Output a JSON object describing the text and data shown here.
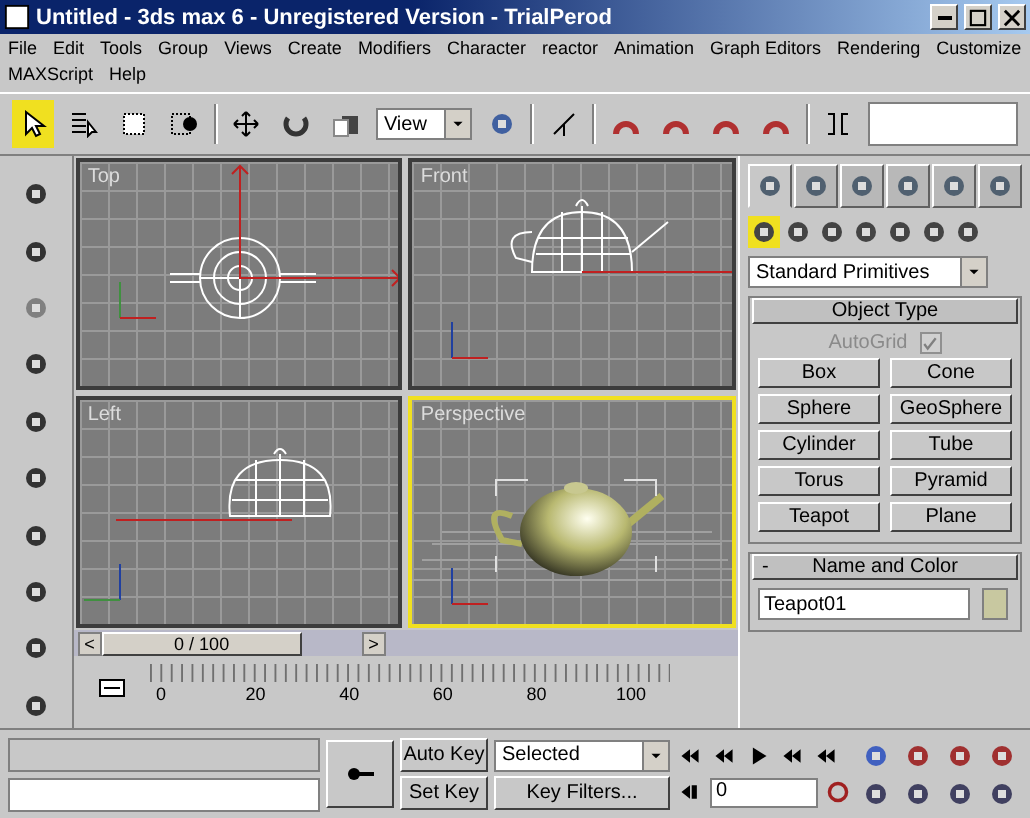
{
  "window": {
    "title": "Untitled - 3ds max 6 - Unregistered Version - TrialPerod"
  },
  "menu": [
    "File",
    "Edit",
    "Tools",
    "Group",
    "Views",
    "Create",
    "Modifiers",
    "Character",
    "reactor",
    "Animation",
    "Graph Editors",
    "Rendering",
    "Customize",
    "MAXScript",
    "Help"
  ],
  "toolbar": {
    "tools": [
      {
        "selected": true
      },
      {
        "selected": false
      },
      {
        "selected": false
      },
      {
        "selected": false
      }
    ],
    "coordinate_system": "View"
  },
  "viewports": [
    {
      "label": "Top",
      "kind": "top",
      "active": false
    },
    {
      "label": "Front",
      "kind": "front",
      "active": false
    },
    {
      "label": "Left",
      "kind": "left",
      "active": false
    },
    {
      "label": "Perspective",
      "kind": "perspective",
      "active": true
    }
  ],
  "time_slider": {
    "prev": "<",
    "position": "0 / 100",
    "next": ">"
  },
  "ruler": {
    "labels": [
      "0",
      "20",
      "40",
      "60",
      "80",
      "100"
    ]
  },
  "command_panel": {
    "tabs": [
      {
        "selected": true
      },
      {
        "selected": false
      },
      {
        "selected": false
      },
      {
        "selected": false
      },
      {
        "selected": false
      },
      {
        "selected": false
      }
    ],
    "categories": [
      {
        "selected": true
      },
      {
        "selected": false
      },
      {
        "selected": false
      },
      {
        "selected": false
      },
      {
        "selected": false
      },
      {
        "selected": false
      },
      {
        "selected": false
      }
    ],
    "dropdown": "Standard Primitives",
    "object_type": {
      "title": "Object Type",
      "autogrid": {
        "label": "AutoGrid",
        "checked": true,
        "disabled": true
      },
      "buttons": [
        "Box",
        "Cone",
        "Sphere",
        "GeoSphere",
        "Cylinder",
        "Tube",
        "Torus",
        "Pyramid",
        "Teapot",
        "Plane"
      ]
    },
    "name_and_color": {
      "toggle": "-",
      "title": "Name and Color",
      "name": "Teapot01",
      "color": "#c8c8a0"
    }
  },
  "animation": {
    "auto_key": "Auto Key",
    "set_key": "Set Key",
    "selection": "Selected",
    "key_filters": "Key Filters...",
    "frame": "0"
  }
}
